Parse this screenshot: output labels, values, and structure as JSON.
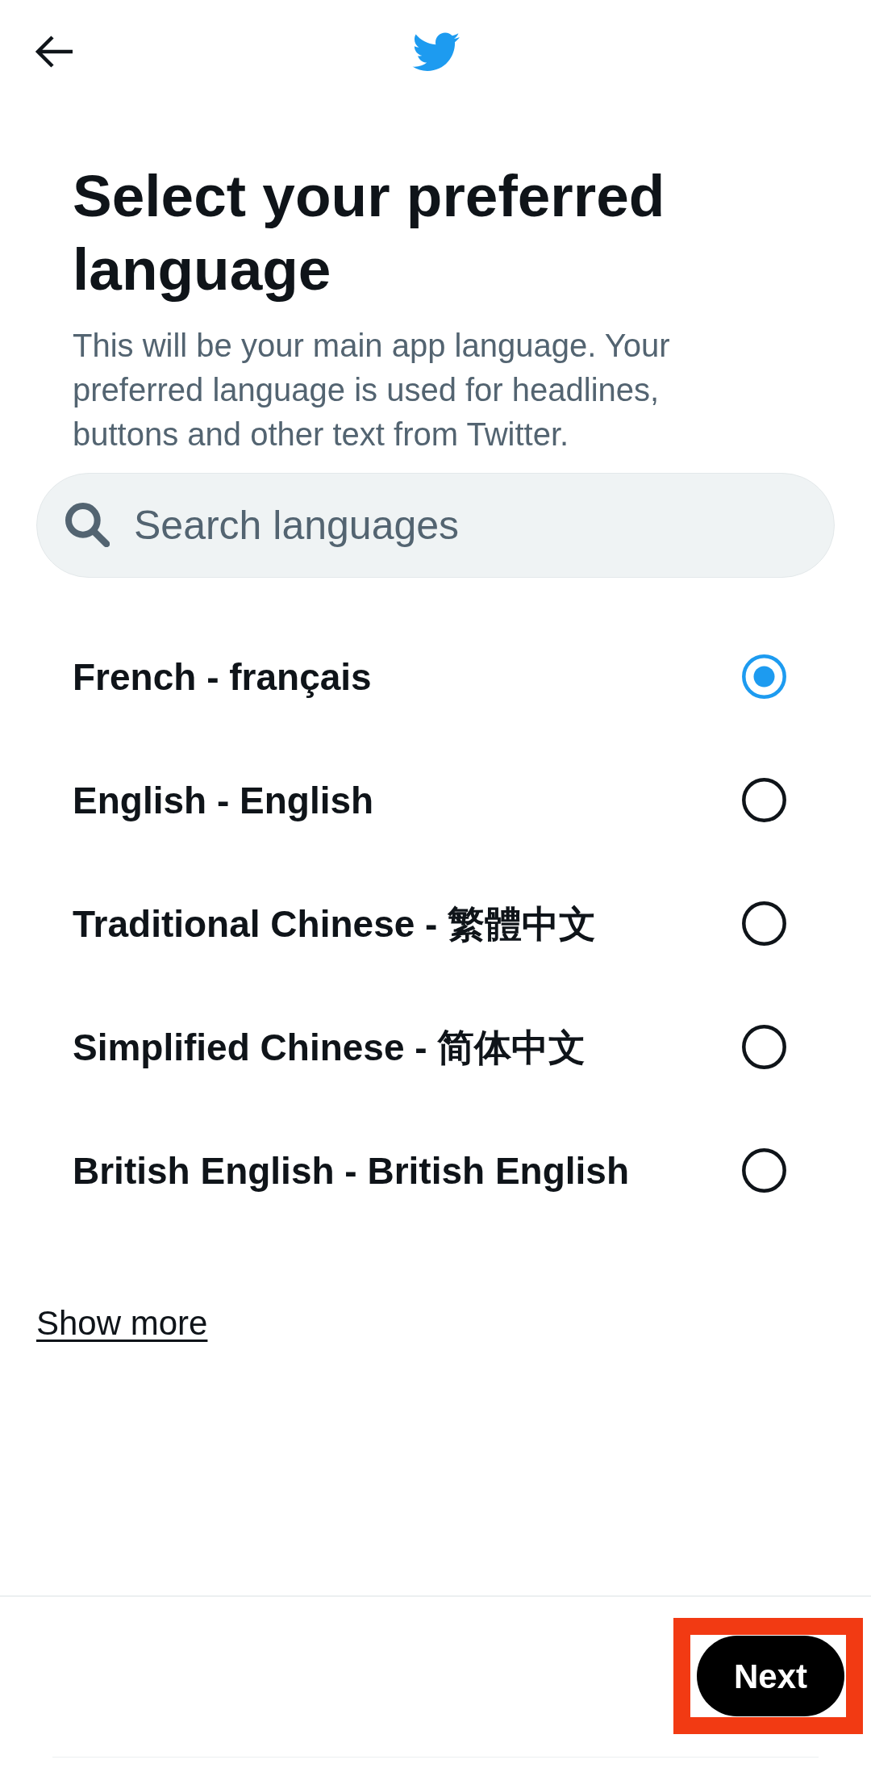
{
  "title": "Select your preferred language",
  "description": "This will be your main app language. Your preferred language is used for headlines, buttons and other text from Twitter.",
  "search": {
    "placeholder": "Search languages"
  },
  "languages": [
    {
      "label": "French - français",
      "selected": true
    },
    {
      "label": "English - English",
      "selected": false
    },
    {
      "label": "Traditional Chinese - 繁體中文",
      "selected": false
    },
    {
      "label": "Simplified Chinese - 简体中文",
      "selected": false
    },
    {
      "label": "British English - British English",
      "selected": false
    }
  ],
  "show_more": "Show more",
  "next_button": {
    "label": "Next",
    "highlighted": true
  }
}
